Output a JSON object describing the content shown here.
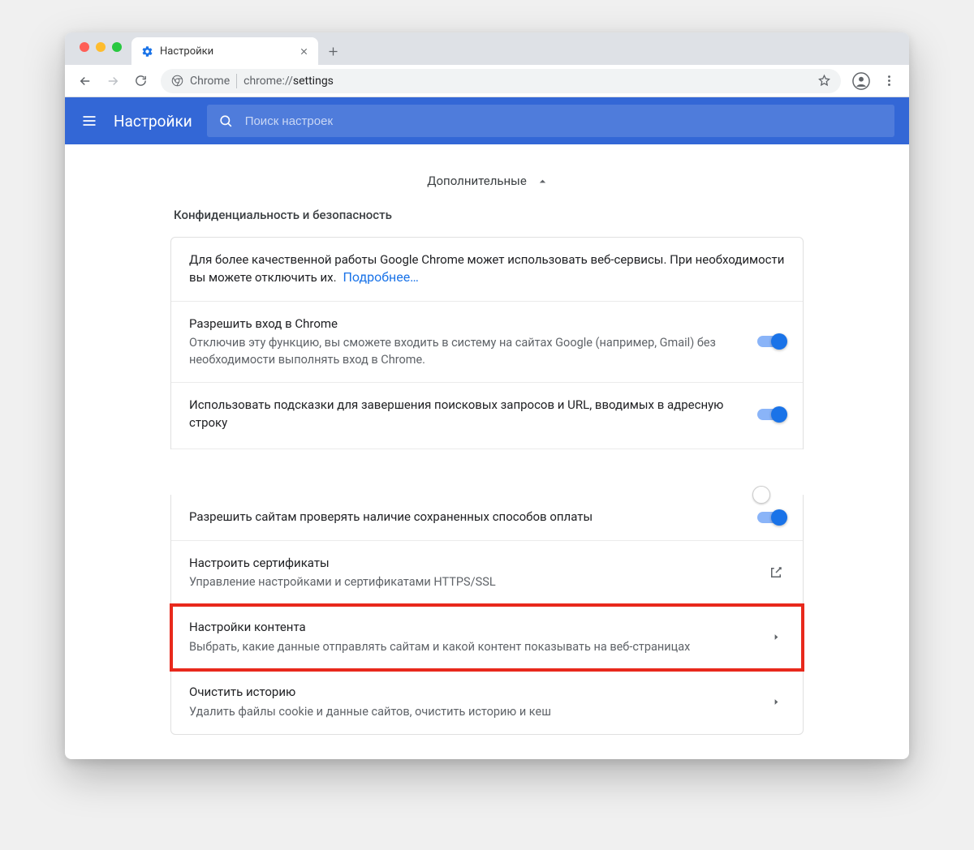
{
  "tab": {
    "title": "Настройки"
  },
  "toolbar": {
    "chrome_label": "Chrome",
    "url_prefix": "chrome://",
    "url_path": "settings"
  },
  "appbar": {
    "title": "Настройки",
    "search_placeholder": "Поиск настроек"
  },
  "expander": {
    "label": "Дополнительные"
  },
  "section": {
    "title": "Конфиденциальность и безопасность"
  },
  "rows": {
    "intro": {
      "text": "Для более качественной работы Google Chrome может использовать веб-сервисы. При необходимости вы можете отключить их.",
      "link": "Подробнее…"
    },
    "signin": {
      "title": "Разрешить вход в Chrome",
      "sub": "Отключив эту функцию, вы сможете входить в систему на сайтах Google (например, Gmail) без необходимости выполнять вход в Chrome."
    },
    "suggestions": {
      "title": "Использовать подсказки для завершения поисковых запросов и URL, вводимых в адресную строку"
    },
    "payment": {
      "title": "Разрешить сайтам проверять наличие сохраненных способов оплаты"
    },
    "certs": {
      "title": "Настроить сертификаты",
      "sub": "Управление настройками и сертификатами HTTPS/SSL"
    },
    "contentSettings": {
      "title": "Настройки контента",
      "sub": "Выбрать, какие данные отправлять сайтам и какой контент показывать на веб-страницах"
    },
    "clear": {
      "title": "Очистить историю",
      "sub": "Удалить файлы cookie и данные сайтов, очистить историю и кеш"
    }
  }
}
